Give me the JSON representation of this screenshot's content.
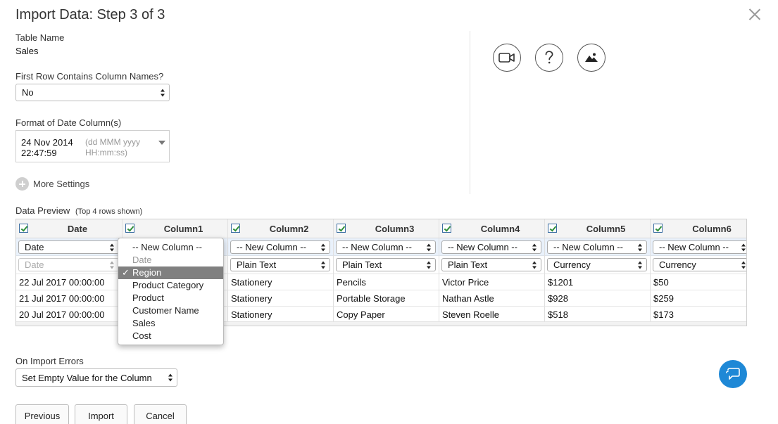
{
  "dialog": {
    "title": "Import Data: Step 3 of 3"
  },
  "settings": {
    "table_name_label": "Table Name",
    "table_name_value": "Sales",
    "first_row_label": "First Row Contains Column Names?",
    "first_row_value": "No",
    "date_format_label": "Format of Date Column(s)",
    "date_format_value": "24 Nov 2014 22:47:59",
    "date_format_hint": "(dd MMM yyyy HH:mm:ss)",
    "more_settings_label": "More Settings"
  },
  "toolbar_icons": [
    "video-icon",
    "help-icon",
    "image-icon"
  ],
  "preview": {
    "title": "Data Preview",
    "subtitle": "(Top 4 rows shown)",
    "columns": [
      {
        "header": "Date",
        "mapping": "Date",
        "type": "Date",
        "type_disabled": true,
        "cells": [
          "22 Jul 2017 00:00:00",
          "21 Jul 2017 00:00:00",
          "20 Jul 2017 00:00:00"
        ]
      },
      {
        "header": "Column1",
        "mapping": "Region",
        "type": "",
        "type_disabled": false,
        "cells": [
          "",
          "",
          ""
        ]
      },
      {
        "header": "Column2",
        "mapping": "-- New Column --",
        "type": "Plain Text",
        "type_disabled": false,
        "cells": [
          "Stationery",
          "Stationery",
          "Stationery"
        ]
      },
      {
        "header": "Column3",
        "mapping": "-- New Column --",
        "type": "Plain Text",
        "type_disabled": false,
        "cells": [
          "Pencils",
          "Portable Storage",
          "Copy Paper"
        ]
      },
      {
        "header": "Column4",
        "mapping": "-- New Column --",
        "type": "Plain Text",
        "type_disabled": false,
        "cells": [
          "Victor Price",
          "Nathan Astle",
          "Steven Roelle"
        ]
      },
      {
        "header": "Column5",
        "mapping": "-- New Column --",
        "type": "Currency",
        "type_disabled": false,
        "cells": [
          "$1201",
          "$928",
          "$518"
        ]
      },
      {
        "header": "Column6",
        "mapping": "-- New Column --",
        "type": "Currency",
        "type_disabled": false,
        "cells": [
          "$50",
          "$259",
          "$173"
        ]
      }
    ]
  },
  "column_dropdown": {
    "options": [
      {
        "label": "-- New Column --",
        "disabled": false,
        "selected": false
      },
      {
        "label": "Date",
        "disabled": true,
        "selected": false
      },
      {
        "label": "Region",
        "disabled": false,
        "selected": true
      },
      {
        "label": "Product Category",
        "disabled": false,
        "selected": false
      },
      {
        "label": "Product",
        "disabled": false,
        "selected": false
      },
      {
        "label": "Customer Name",
        "disabled": false,
        "selected": false
      },
      {
        "label": "Sales",
        "disabled": false,
        "selected": false
      },
      {
        "label": "Cost",
        "disabled": false,
        "selected": false
      }
    ],
    "check_mark": "✓"
  },
  "import_errors": {
    "label": "On Import Errors",
    "value": "Set Empty Value for the Column"
  },
  "buttons": {
    "previous": "Previous",
    "import": "Import",
    "cancel": "Cancel"
  },
  "colors": {
    "accent": "#1e88d6",
    "mapping_row_bg": "#e9f1fb",
    "selected_option_bg": "#808080"
  }
}
